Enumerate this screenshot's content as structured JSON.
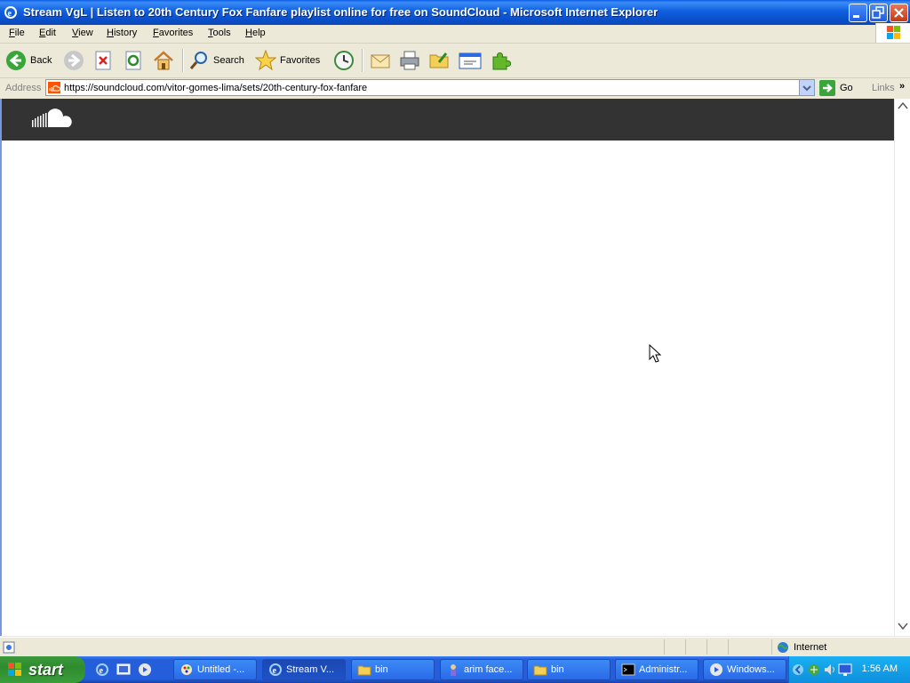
{
  "window": {
    "title": "Stream VgL | Listen to 20th Century Fox Fanfare playlist online for free on SoundCloud - Microsoft Internet Explorer"
  },
  "menubar": {
    "items": [
      "File",
      "Edit",
      "View",
      "History",
      "Favorites",
      "Tools",
      "Help"
    ]
  },
  "toolbar": {
    "back_label": "Back",
    "search_label": "Search",
    "favorites_label": "Favorites"
  },
  "address": {
    "label": "Address",
    "url": "https://soundcloud.com/vitor-gomes-lima/sets/20th-century-fox-fanfare",
    "go_label": "Go",
    "links_label": "Links"
  },
  "status": {
    "zone": "Internet"
  },
  "taskbar": {
    "start_label": "start",
    "tasks": [
      "Untitled -...",
      "Stream V...",
      "bin",
      "arim face...",
      "bin",
      "Administr...",
      "Windows..."
    ],
    "clock": "1:56 AM"
  },
  "colors": {
    "titlebar": "#0a5ee6",
    "soundcloud_header": "#333333",
    "soundcloud_orange": "#ff5500",
    "taskbar": "#245edb",
    "start": "#3c9a3c"
  }
}
